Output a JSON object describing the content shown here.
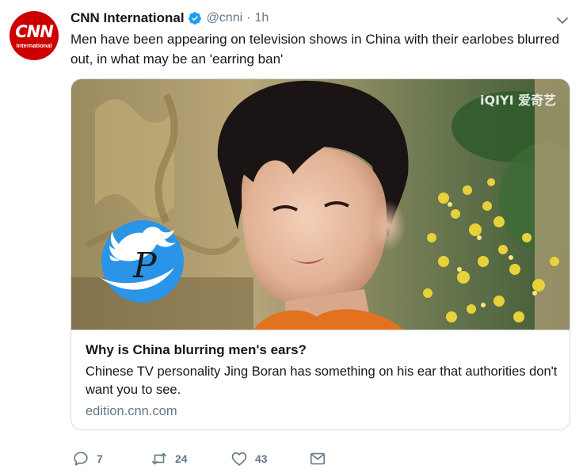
{
  "account": {
    "avatar_text": "CNN",
    "avatar_subtext": "International",
    "name": "CNN International",
    "handle": "@cnni",
    "separator": "·",
    "time": "1h",
    "verified": true
  },
  "tweet": {
    "text": "Men have been appearing on television shows in China with their earlobes blurred out, in what may be an 'earring ban'"
  },
  "card": {
    "watermark": "iQIYI 爱奇艺",
    "overlay_logo": "P",
    "title": "Why is China blurring men's ears?",
    "description": "Chinese TV personality Jing Boran has something on his ear that authorities don't want you to see.",
    "domain": "edition.cnn.com"
  },
  "actions": {
    "replies": "7",
    "retweets": "24",
    "likes": "43"
  },
  "icons": {
    "reply": "reply-icon",
    "retweet": "retweet-icon",
    "like": "heart-icon",
    "dm": "envelope-icon",
    "caret": "chevron-down-icon",
    "verified": "verified-badge-icon"
  },
  "colors": {
    "brand_red": "#cc0000",
    "verified_blue": "#1da1f2",
    "muted": "#657786",
    "text": "#14171a"
  }
}
